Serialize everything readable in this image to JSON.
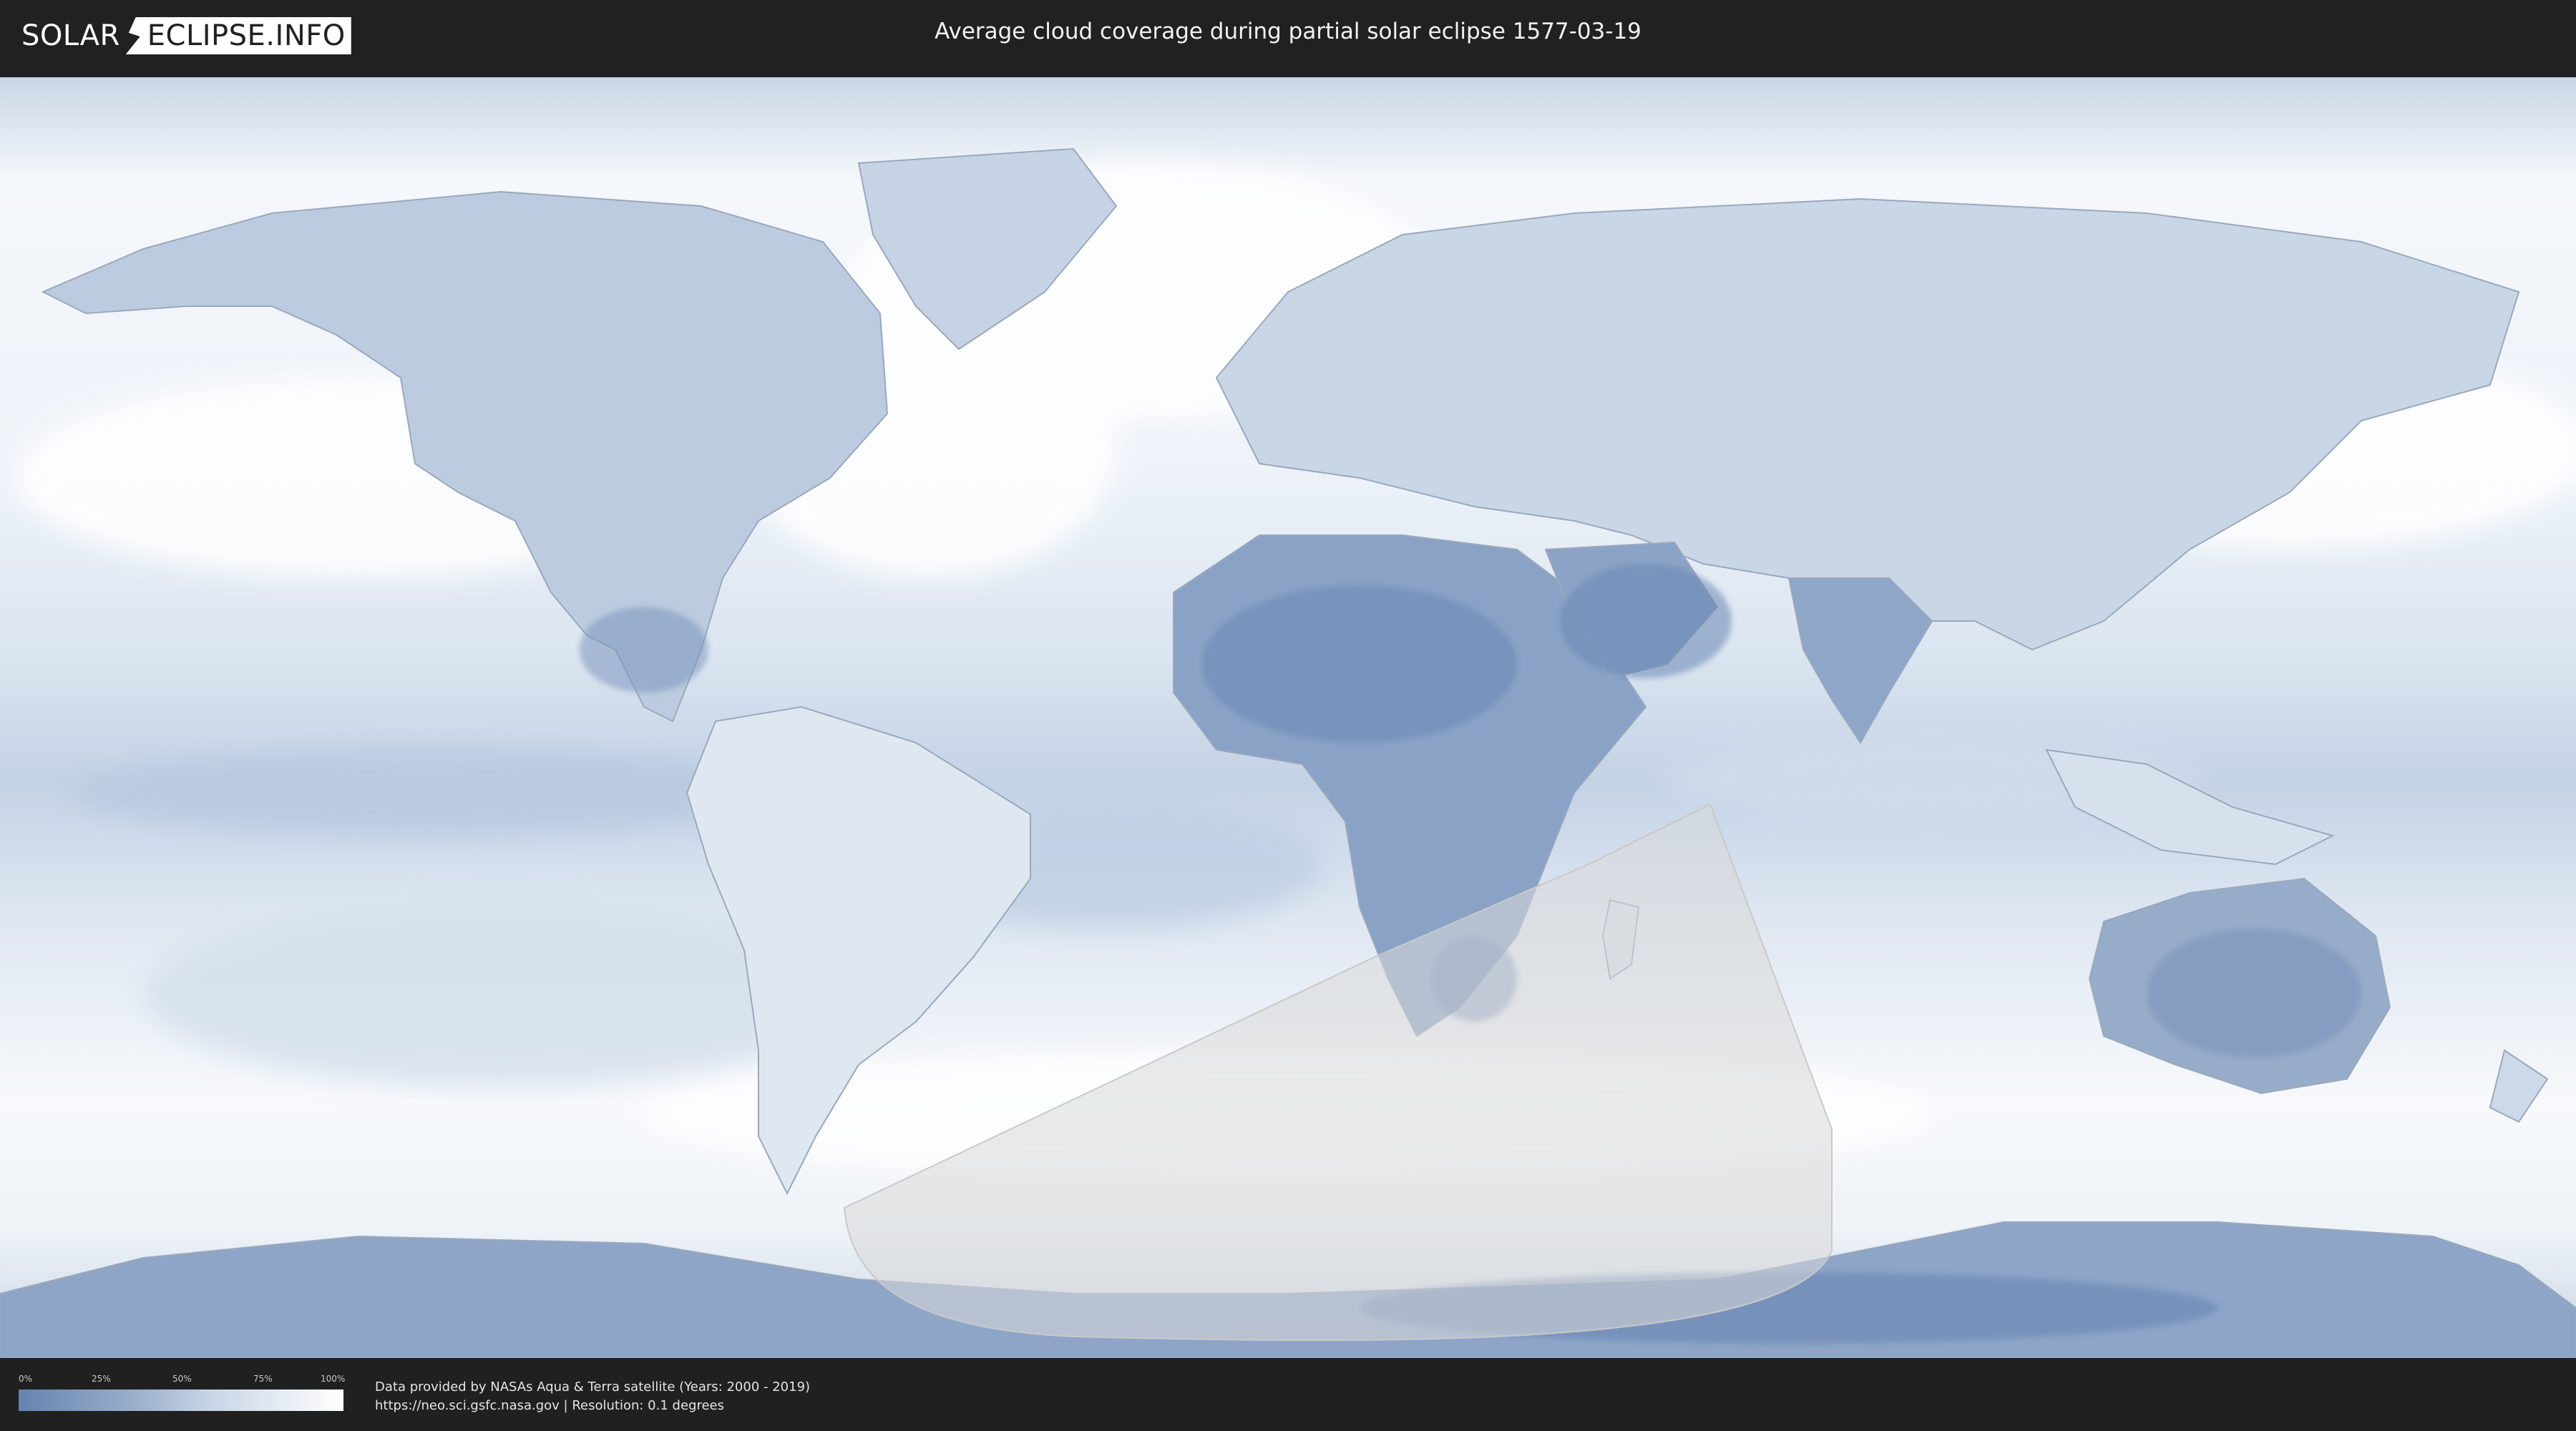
{
  "header": {
    "logo_left": "SOLAR",
    "logo_right": "ECLIPSE.INFO",
    "title": "Average cloud coverage during partial solar eclipse 1577-03-19"
  },
  "legend": {
    "ticks": [
      "0%",
      "25%",
      "50%",
      "75%",
      "100%"
    ]
  },
  "credit": {
    "line1": "Data provided by NASAs Aqua & Terra satellite (Years: 2000 - 2019)",
    "line2": "https://neo.sci.gsfc.nasa.gov | Resolution: 0.1 degrees"
  },
  "colors": {
    "header_bg": "#212121",
    "ocean_cloud": "#e6eef6",
    "land_dark": "#6e8bb8",
    "eclipse_zone": "#d9d9d9"
  }
}
